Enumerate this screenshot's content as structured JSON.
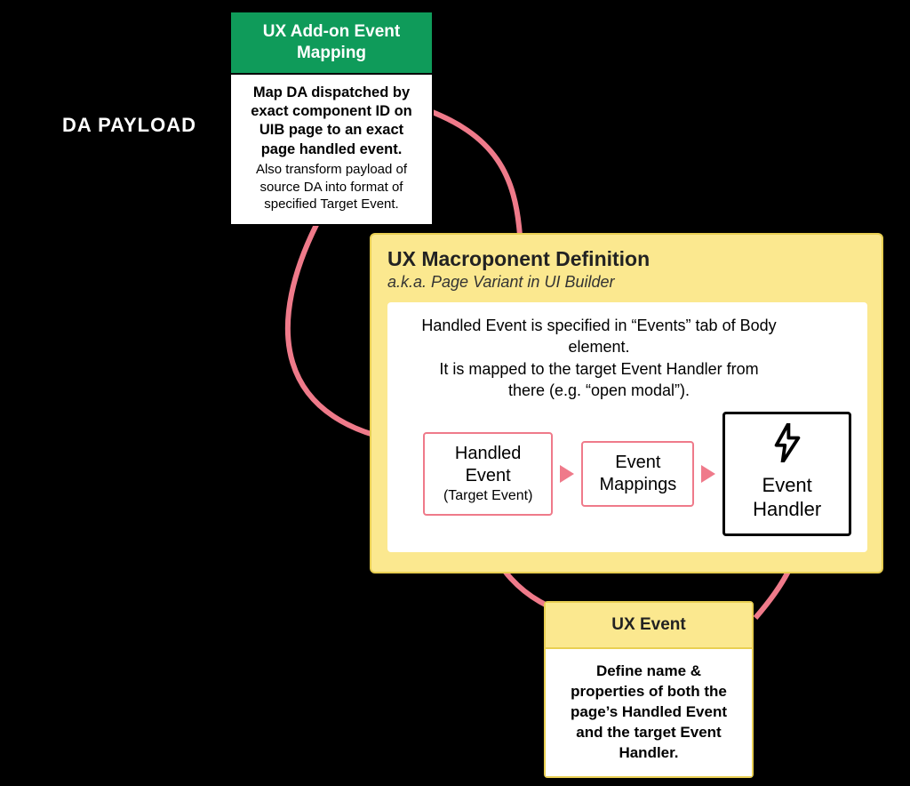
{
  "labels": {
    "da_payload": "DA PAYLOAD"
  },
  "addon": {
    "title": "UX Add-on Event Mapping",
    "body_bold": "Map DA dispatched by exact component ID on UIB page to an exact page handled event.",
    "body_sub": "Also transform payload of source DA into format of specified Target Event."
  },
  "macro": {
    "title": "UX Macroponent Definition",
    "subtitle": "a.k.a. Page Variant in UI Builder",
    "description": "Handled Event is specified in “Events” tab of Body element.\nIt is mapped to the target Event Handler from there (e.g. “open modal”).",
    "handled_event": {
      "label": "Handled Event",
      "sublabel": "(Target Event)"
    },
    "event_mappings": "Event Mappings",
    "event_handler": "Event Handler"
  },
  "uxevent": {
    "title": "UX Event",
    "body": "Define name & properties of both the page’s Handled Event and the target Event Handler."
  },
  "arrows": {
    "right1": "▶",
    "right2": "▶"
  },
  "colors": {
    "pink": "#ef7a8a",
    "green": "#0f9b5a",
    "yellow": "#fbe88f",
    "black": "#000000"
  }
}
